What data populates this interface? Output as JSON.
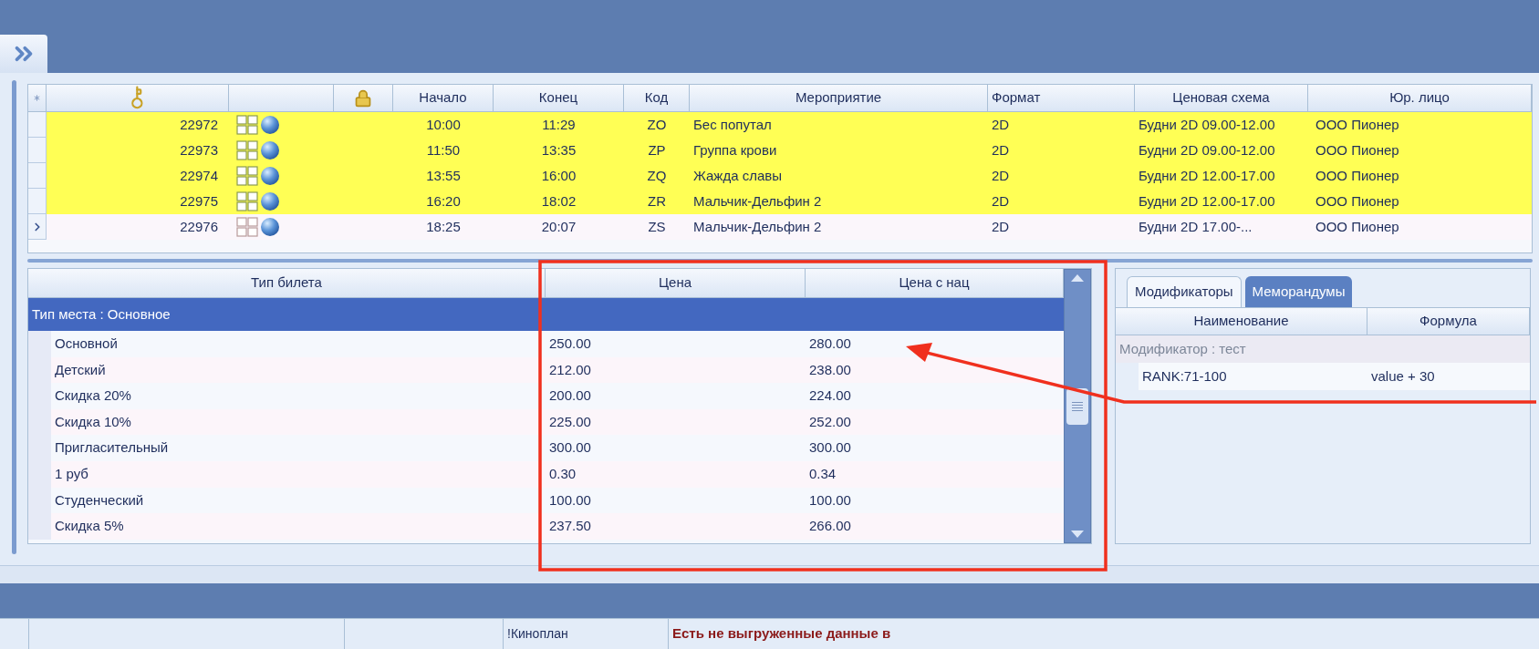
{
  "sessions": {
    "columns": [
      {
        "kind": "new-row"
      },
      {
        "kind": "key"
      },
      {
        "kind": "blank"
      },
      {
        "kind": "lock"
      },
      {
        "kind": "text",
        "label": "Начало"
      },
      {
        "kind": "text",
        "label": "Конец"
      },
      {
        "kind": "text",
        "label": "Код"
      },
      {
        "kind": "text",
        "label": "Мероприятие"
      },
      {
        "kind": "text",
        "label": "Формат"
      },
      {
        "kind": "text",
        "label": "Ценовая схема"
      },
      {
        "kind": "text",
        "label": "Юр. лицо"
      }
    ],
    "rows": [
      {
        "id": "22972",
        "start": "10:00",
        "end": "11:29",
        "code": "ZO",
        "event": "Бес попутал",
        "format": "2D",
        "price_scheme": "Будни 2D 09.00-12.00",
        "legal_entity": "ООО Пионер",
        "highlighted": true,
        "current": false
      },
      {
        "id": "22973",
        "start": "11:50",
        "end": "13:35",
        "code": "ZP",
        "event": "Группа крови",
        "format": "2D",
        "price_scheme": "Будни 2D 09.00-12.00",
        "legal_entity": "ООО Пионер",
        "highlighted": true,
        "current": false
      },
      {
        "id": "22974",
        "start": "13:55",
        "end": "16:00",
        "code": "ZQ",
        "event": "Жажда славы",
        "format": "2D",
        "price_scheme": "Будни 2D 12.00-17.00",
        "legal_entity": "ООО Пионер",
        "highlighted": true,
        "current": false
      },
      {
        "id": "22975",
        "start": "16:20",
        "end": "18:02",
        "code": "ZR",
        "event": "Мальчик-Дельфин 2",
        "format": "2D",
        "price_scheme": "Будни 2D 12.00-17.00",
        "legal_entity": "ООО Пионер",
        "highlighted": true,
        "current": false
      },
      {
        "id": "22976",
        "start": "18:25",
        "end": "20:07",
        "code": "ZS",
        "event": "Мальчик-Дельфин 2",
        "format": "2D",
        "price_scheme": "Будни 2D 17.00-...",
        "legal_entity": "ООО Пионер",
        "highlighted": false,
        "current": true
      }
    ]
  },
  "ticket_prices": {
    "columns": [
      "Тип билета",
      "Цена",
      "Цена с нац"
    ],
    "group": {
      "label": "Тип места : Основное",
      "selected": true
    },
    "rows": [
      {
        "type": "Основной",
        "price": "250.00",
        "price_with_markup": "280.00"
      },
      {
        "type": "Детский",
        "price": "212.00",
        "price_with_markup": "238.00"
      },
      {
        "type": "Скидка 20%",
        "price": "200.00",
        "price_with_markup": "224.00"
      },
      {
        "type": "Скидка 10%",
        "price": "225.00",
        "price_with_markup": "252.00"
      },
      {
        "type": "Пригласительный",
        "price": "300.00",
        "price_with_markup": "300.00"
      },
      {
        "type": "1 руб",
        "price": "0.30",
        "price_with_markup": "0.34"
      },
      {
        "type": "Студенческий",
        "price": "100.00",
        "price_with_markup": "100.00"
      },
      {
        "type": "Скидка 5%",
        "price": "237.50",
        "price_with_markup": "266.00"
      }
    ]
  },
  "side_panel": {
    "tabs": [
      {
        "label": "Модификаторы",
        "selected": true
      },
      {
        "label": "Меморандумы",
        "selected": false
      }
    ],
    "columns": [
      "Наименование",
      "Формула"
    ],
    "group": "Модификатор : тест",
    "rows": [
      {
        "name": "RANK:71-100",
        "formula": "value + 30"
      }
    ]
  },
  "status_bar": {
    "cells": [
      {
        "kind": "empty"
      },
      {
        "kind": "empty"
      },
      {
        "kind": "empty"
      },
      {
        "kind": "text",
        "text": "!Киноплан"
      },
      {
        "kind": "warning",
        "text": "Есть не выгруженные данные в"
      }
    ]
  }
}
